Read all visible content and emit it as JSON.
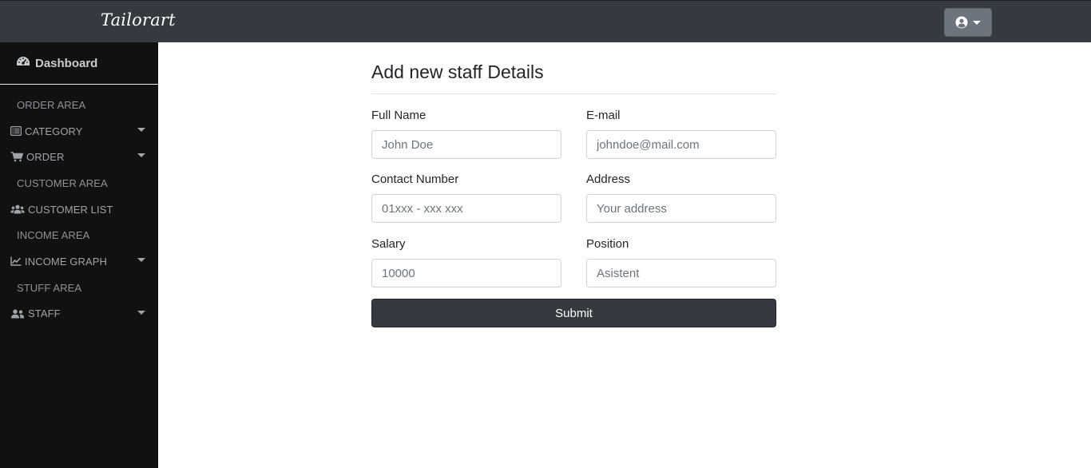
{
  "header": {
    "brand": "Tailorart",
    "user_menu_icon": "user-circle-icon"
  },
  "sidebar": {
    "dashboard": {
      "label": "Dashboard",
      "icon": "tachometer-icon"
    },
    "items": [
      {
        "kind": "heading",
        "label": "ORDER AREA"
      },
      {
        "kind": "item",
        "label": "CATEGORY",
        "icon": "list-alt-icon",
        "dropdown": true
      },
      {
        "kind": "item",
        "label": "ORDER",
        "icon": "shopping-cart-icon",
        "dropdown": true
      },
      {
        "kind": "heading",
        "label": "CUSTOMER AREA"
      },
      {
        "kind": "item",
        "label": "CUSTOMER LIST",
        "icon": "users-icon",
        "dropdown": false
      },
      {
        "kind": "heading",
        "label": "INCOME AREA"
      },
      {
        "kind": "item",
        "label": "INCOME GRAPH",
        "icon": "chart-line-icon",
        "dropdown": true
      },
      {
        "kind": "heading",
        "label": "STUFF AREA"
      },
      {
        "kind": "item",
        "label": "STAFF",
        "icon": "user-friends-icon",
        "dropdown": true
      }
    ]
  },
  "form": {
    "title": "Add new staff Details",
    "fields": {
      "full_name": {
        "label": "Full Name",
        "placeholder": "John Doe",
        "value": ""
      },
      "email": {
        "label": "E-mail",
        "placeholder": "johndoe@mail.com",
        "value": ""
      },
      "contact": {
        "label": "Contact Number",
        "placeholder": "01xxx - xxx xxx",
        "value": ""
      },
      "address": {
        "label": "Address",
        "placeholder": "Your address",
        "value": ""
      },
      "salary": {
        "label": "Salary",
        "placeholder": "10000",
        "value": ""
      },
      "position": {
        "label": "Position",
        "placeholder": "Asistent",
        "value": ""
      }
    },
    "submit_label": "Submit"
  },
  "colors": {
    "topbar": "#343a40",
    "sidebar": "#111111",
    "user_button": "#6c757d",
    "submit_button": "#343a40"
  }
}
